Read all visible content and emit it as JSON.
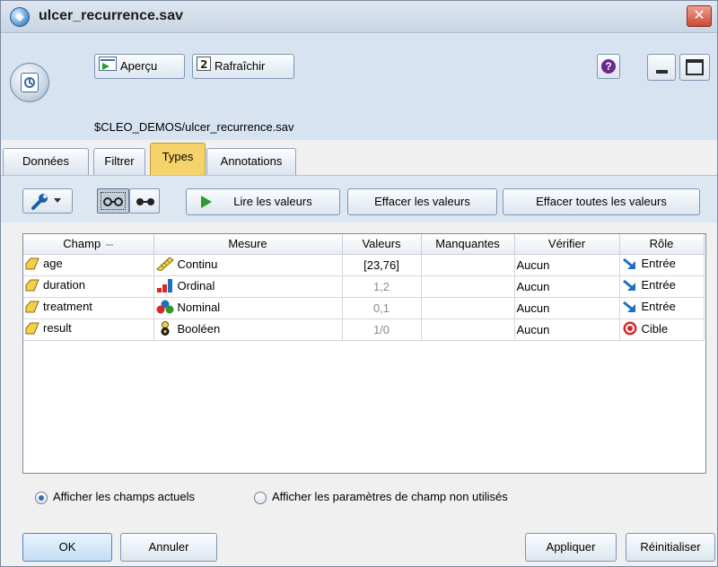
{
  "window": {
    "title": "ulcer_recurrence.sav",
    "close_label": "✕"
  },
  "toolbar": {
    "preview_label": "Aperçu",
    "refresh_label": "Rafraîchir",
    "help_label": "?",
    "path": "$CLEO_DEMOS/ulcer_recurrence.sav"
  },
  "tabs": [
    {
      "label": "Données"
    },
    {
      "label": "Filtrer"
    },
    {
      "label": "Types",
      "active": true
    },
    {
      "label": "Annotations"
    }
  ],
  "types_toolbar": {
    "read_values_label": "Lire les valeurs",
    "clear_values_label": "Effacer les valeurs",
    "clear_all_values_label": "Effacer toutes les valeurs"
  },
  "table": {
    "columns": [
      "Champ",
      "Mesure",
      "Valeurs",
      "Manquantes",
      "Vérifier",
      "Rôle"
    ],
    "rows": [
      {
        "field": "age",
        "measure": "Continu",
        "measure_icon": "ruler-icon",
        "values": "[23,76]",
        "values_greyed": false,
        "missing": "",
        "check": "Aucun",
        "role": "Entrée",
        "role_icon": "input-arrow-icon"
      },
      {
        "field": "duration",
        "measure": "Ordinal",
        "measure_icon": "ordinal-bars-icon",
        "values": "1,2",
        "values_greyed": true,
        "missing": "",
        "check": "Aucun",
        "role": "Entrée",
        "role_icon": "input-arrow-icon"
      },
      {
        "field": "treatment",
        "measure": "Nominal",
        "measure_icon": "nominal-circles-icon",
        "values": "0,1",
        "values_greyed": true,
        "missing": "",
        "check": "Aucun",
        "role": "Entrée",
        "role_icon": "input-arrow-icon"
      },
      {
        "field": "result",
        "measure": "Booléen",
        "measure_icon": "flag-icon",
        "values": "1/0",
        "values_greyed": true,
        "missing": "",
        "check": "Aucun",
        "role": "Cible",
        "role_icon": "target-icon"
      }
    ]
  },
  "options": {
    "show_current_label": "Afficher les champs actuels",
    "show_unused_label": "Afficher les paramètres de champ non utilisés",
    "selected": "show_current"
  },
  "buttons": {
    "ok_label": "OK",
    "cancel_label": "Annuler",
    "apply_label": "Appliquer",
    "reset_label": "Réinitialiser"
  },
  "colors": {
    "active_tab": "#f6d36a",
    "toolbar_bg": "#d7e3f1",
    "play_green": "#2b9c2b",
    "role_blue": "#1e6fbf",
    "target_red": "#d42a2a"
  }
}
